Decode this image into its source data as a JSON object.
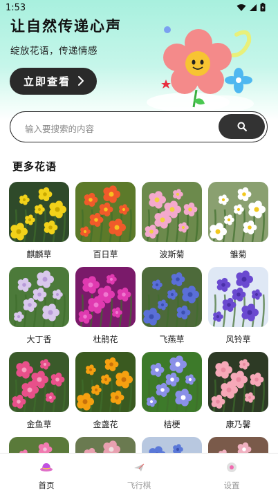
{
  "status_bar": {
    "time": "1:53"
  },
  "hero": {
    "title": "让自然传递心声",
    "subtitle": "绽放花语，传递情感",
    "cta_label": "立即查看"
  },
  "search": {
    "placeholder": "输入要搜索的内容"
  },
  "section": {
    "title": "更多花语"
  },
  "flowers": [
    {
      "name": "麒麟草",
      "bg": "#2f4a2a",
      "petal": "#f2d21a",
      "center": "#c9a800"
    },
    {
      "name": "百日草",
      "bg": "#5c7a2a",
      "petal": "#f05a2a",
      "center": "#f7c020"
    },
    {
      "name": "波斯菊",
      "bg": "#6c8a4c",
      "petal": "#f4a9cc",
      "center": "#f0d040"
    },
    {
      "name": "雏菊",
      "bg": "#8aa070",
      "petal": "#ffffff",
      "center": "#f2c81e"
    },
    {
      "name": "大丁香",
      "bg": "#4c7a3a",
      "petal": "#d8c8ec",
      "center": "#b79ad8"
    },
    {
      "name": "杜鹃花",
      "bg": "#7a1a6a",
      "petal": "#e03ab0",
      "center": "#f078d0"
    },
    {
      "name": "飞燕草",
      "bg": "#4d6a3a",
      "petal": "#5a6fd8",
      "center": "#3b4fb0"
    },
    {
      "name": "风铃草",
      "bg": "#dfe8f5",
      "petal": "#6a4ad0",
      "center": "#4a2fa8"
    },
    {
      "name": "金鱼草",
      "bg": "#3a5a2a",
      "petal": "#e8508a",
      "center": "#f7a0c0"
    },
    {
      "name": "金盏花",
      "bg": "#3a5a20",
      "petal": "#f5a010",
      "center": "#c8700a"
    },
    {
      "name": "桔梗",
      "bg": "#3d7a2a",
      "petal": "#8a90e8",
      "center": "#ffffff"
    },
    {
      "name": "康乃馨",
      "bg": "#2d3a25",
      "petal": "#f6a8b8",
      "center": "#e98aa0"
    },
    {
      "name": "",
      "bg": "#5a7a3a",
      "petal": "#f07ab0",
      "center": "#f0c0d8"
    },
    {
      "name": "",
      "bg": "#6a7a50",
      "petal": "#e8a0b0",
      "center": "#f0e0e0"
    },
    {
      "name": "",
      "bg": "#b8c8e0",
      "petal": "#5a78d8",
      "center": "#3a50b0"
    },
    {
      "name": "",
      "bg": "#7a5a4a",
      "petal": "#f0b0c0",
      "center": "#ffffff"
    }
  ],
  "tabs": [
    {
      "label": "首页",
      "icon": "hat-icon",
      "active": true
    },
    {
      "label": "飞行棋",
      "icon": "plane-icon",
      "active": false
    },
    {
      "label": "设置",
      "icon": "settings-icon",
      "active": false
    }
  ],
  "colors": {
    "accent_dark": "#2a2a2a",
    "hero_mint": "#a8f0de",
    "tab_active": "#222222",
    "tab_inactive": "#9a9a9a"
  }
}
